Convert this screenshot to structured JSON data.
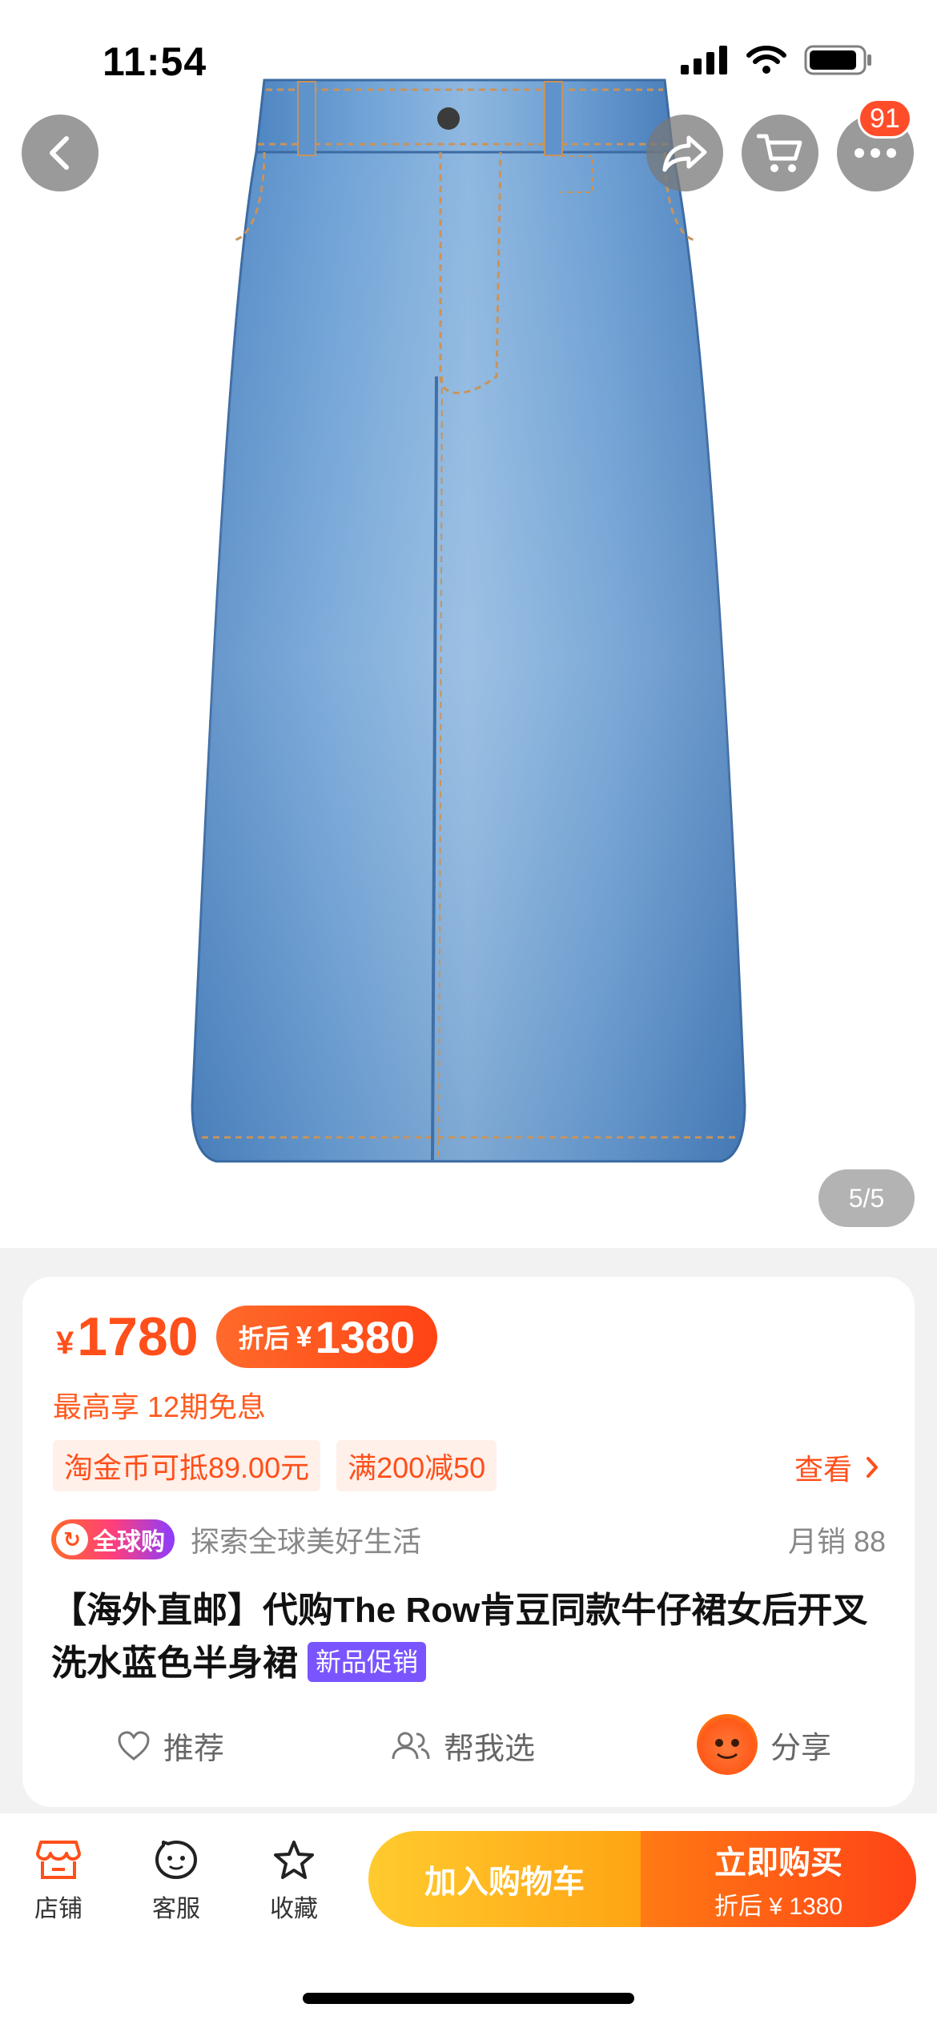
{
  "status_bar": {
    "time": "11:54"
  },
  "hero": {
    "page_indicator": "5/5",
    "more_badge": "91"
  },
  "price": {
    "symbol": "¥",
    "original": "1780",
    "after_label": "折后",
    "after_symbol": "¥",
    "after_value": "1380",
    "installment": "最高享 12期免息"
  },
  "coupons": [
    "淘金币可抵89.00元",
    "满200减50"
  ],
  "view_more": "查看",
  "global": {
    "badge": "全球购",
    "slogan": "探索全球美好生活",
    "monthly_sales": "月销 88"
  },
  "product": {
    "title": "【海外直邮】代购The Row肯豆同款牛仔裙女后开叉洗水蓝色半身裙",
    "promo_tag": "新品促销"
  },
  "actions": {
    "recommend": "推荐",
    "help_choose": "帮我选",
    "share": "分享"
  },
  "bottom_nav": {
    "shop": "店铺",
    "service": "客服",
    "favorite": "收藏",
    "add_to_cart": "加入购物车",
    "buy_now": "立即购买",
    "buy_now_sub": "折后 ¥ 1380"
  },
  "colors": {
    "accent": "#ff4f1a",
    "denim": "#6b9fd4",
    "cart_cta": "#ffb81f",
    "promo_tag": "#7a55ff"
  }
}
